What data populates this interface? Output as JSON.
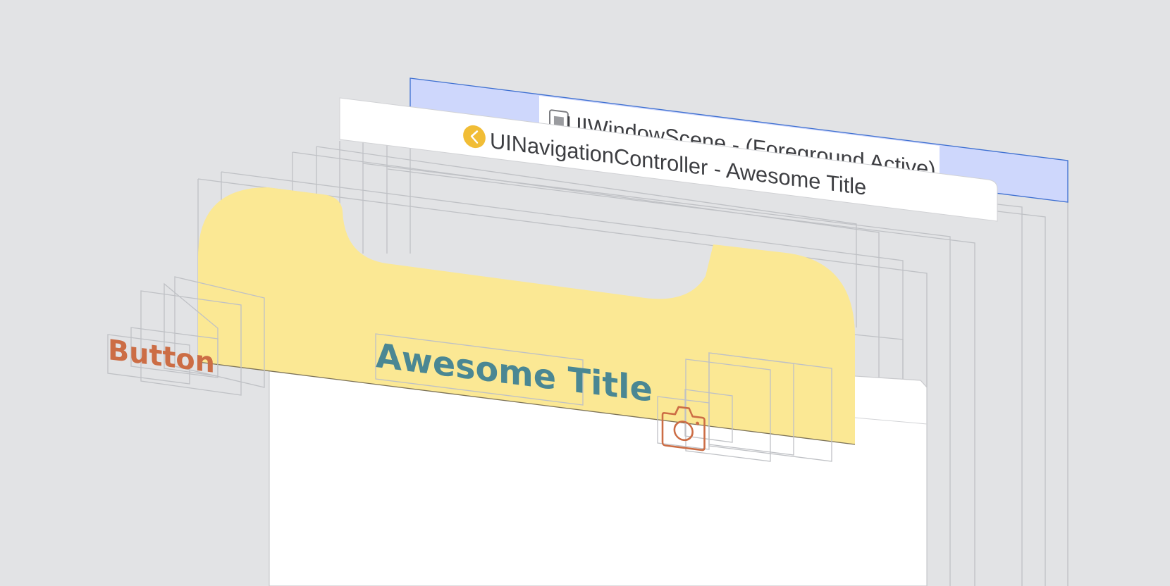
{
  "window_scene": {
    "label": "UIWindowScene - (Foreground Active)",
    "icon": "window-scene-icon"
  },
  "navigation_controller": {
    "label": "UINavigationController - Awesome Title",
    "icon": "back-chevron-icon"
  },
  "nav_bar": {
    "left_button_label": "Button",
    "title": "Awesome Title",
    "right_button_icon": "camera-icon"
  },
  "colors": {
    "background": "#e2e3e5",
    "selection_blue": "#ced7fc",
    "selection_border": "#3d6fd1",
    "nav_bar_yellow": "#fbe894",
    "title_teal": "#4a8793",
    "button_orange": "#cc6d45",
    "nav_icon_yellow": "#f1bd36"
  }
}
